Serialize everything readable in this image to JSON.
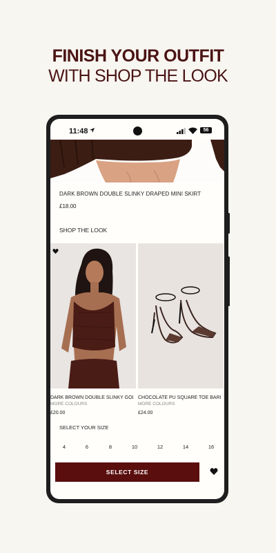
{
  "promo": {
    "line1": "FINISH YOUR OUTFIT",
    "line2": "WITH SHOP THE LOOK"
  },
  "status_bar": {
    "time": "11:48",
    "battery": "56",
    "icons": [
      "location-arrow-icon",
      "camera-cutout",
      "signal-icon",
      "wifi-icon",
      "battery-icon"
    ]
  },
  "product": {
    "name": "DARK BROWN DOUBLE SLINKY DRAPED MINI SKIRT",
    "price": "£18.00"
  },
  "shop_the_look": {
    "heading": "SHOP THE LOOK",
    "items": [
      {
        "name": "DARK BROWN DOUBLE SLINKY GOLD TR...",
        "colours": "",
        "price": "£20.00"
      },
      {
        "name": "CHOCOLATE PU SQUARE TOE BARLEY T...",
        "colours": "MORE COLOURS",
        "price": "£24.00"
      }
    ],
    "more_colours_first": "MORE COLOURS"
  },
  "size_picker": {
    "label": "SELECT YOUR SIZE",
    "sizes": [
      "4",
      "6",
      "8",
      "10",
      "12",
      "14",
      "16"
    ],
    "button": "SELECT SIZE"
  },
  "colors": {
    "brand": "#5a0e0e",
    "headline": "#4a1414",
    "background": "#f8f6f1"
  }
}
